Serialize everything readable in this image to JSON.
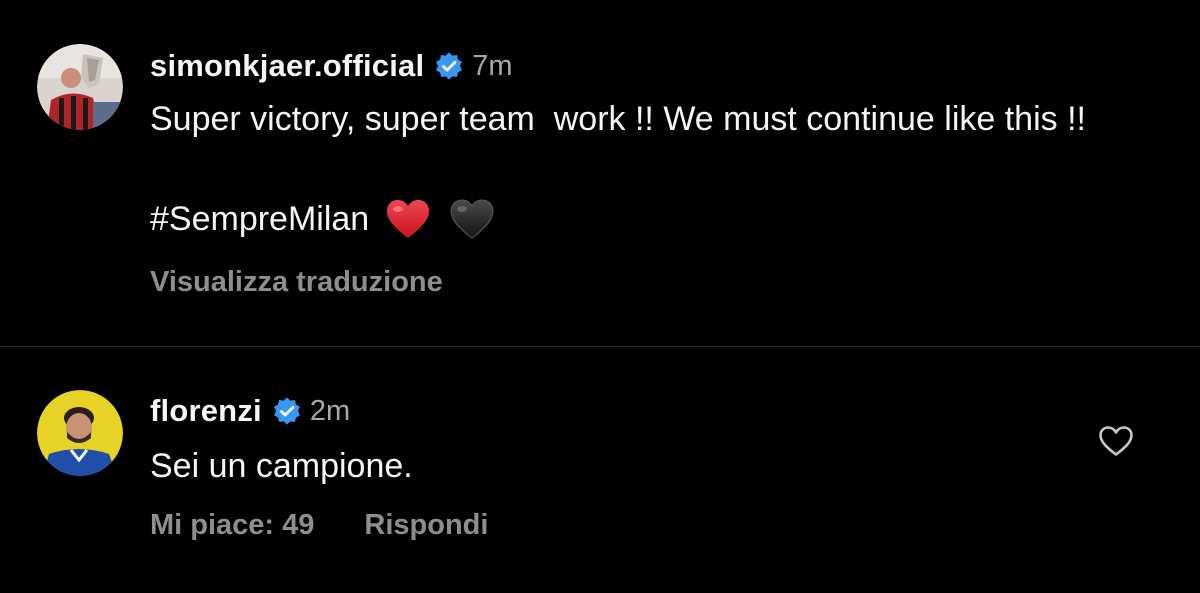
{
  "post": {
    "username": "simonkjaer.official",
    "verified_icon": "verified-badge-icon",
    "time": "7m",
    "caption": "Super victory, super team  work !! We must continue like this !!",
    "hashtag": "#SempreMilan",
    "emojis": [
      "red-heart-icon",
      "black-heart-icon"
    ],
    "translate_label": "Visualizza traduzione",
    "avatar_icon": "user-avatar-icon"
  },
  "comment": {
    "username": "florenzi",
    "verified_icon": "verified-badge-icon",
    "time": "2m",
    "text": "Sei un campione.",
    "likes_label": "Mi piace: 49",
    "reply_label": "Rispondi",
    "like_icon": "heart-outline-icon",
    "avatar_icon": "user-avatar-icon"
  },
  "colors": {
    "background": "#000000",
    "text_primary": "#f5f5f5",
    "text_secondary": "#8e8e8e",
    "verified_blue": "#3897f0",
    "divider": "#262626",
    "avatar_yellow": "#e7d325"
  }
}
